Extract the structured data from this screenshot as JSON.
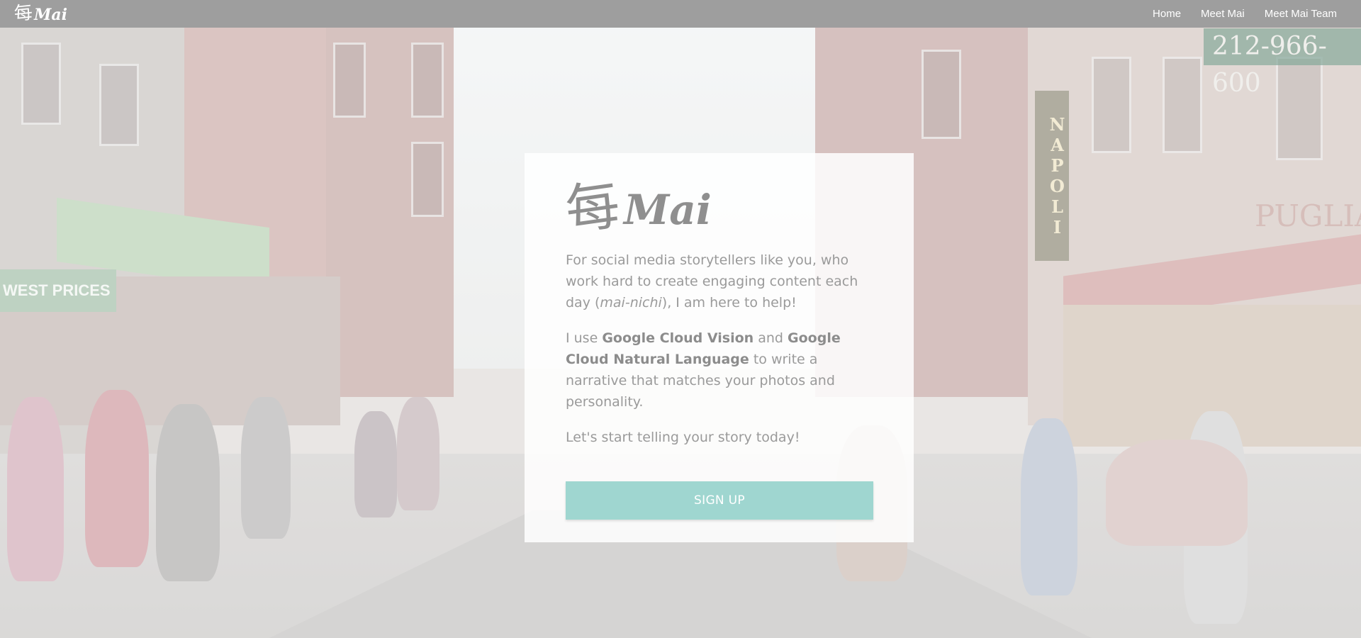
{
  "navbar": {
    "brand_glyph": "每",
    "brand_text": "Mai",
    "links": [
      "Home",
      "Meet Mai",
      "Meet Mai Team"
    ]
  },
  "card": {
    "logo_glyph": "每",
    "logo_text": "Mai",
    "paragraph1": {
      "before": "For social media storytellers like you, who work hard to create engaging content each day (",
      "emphasis": "mai-nichi",
      "after": "), I am here to help!"
    },
    "paragraph2": {
      "part1": "I use ",
      "strong1": "Google Cloud Vision",
      "part2": " and ",
      "strong2": "Google Cloud Natural Language",
      "part3": " to write a narrative that matches your photos and personality."
    },
    "paragraph3": "Let's start telling your story today!",
    "signup_label": "SIGN UP"
  },
  "background": {
    "storefront_phone": "212-966-600",
    "storefront_sign": "NAPOLI",
    "storefront_name": "PUGLIA",
    "left_sign": "WEST PRICES"
  },
  "colors": {
    "navbar": "#9e9e9e",
    "accent": "#9fd6d0",
    "text": "#9a9a9a",
    "card": "#ffffff"
  }
}
